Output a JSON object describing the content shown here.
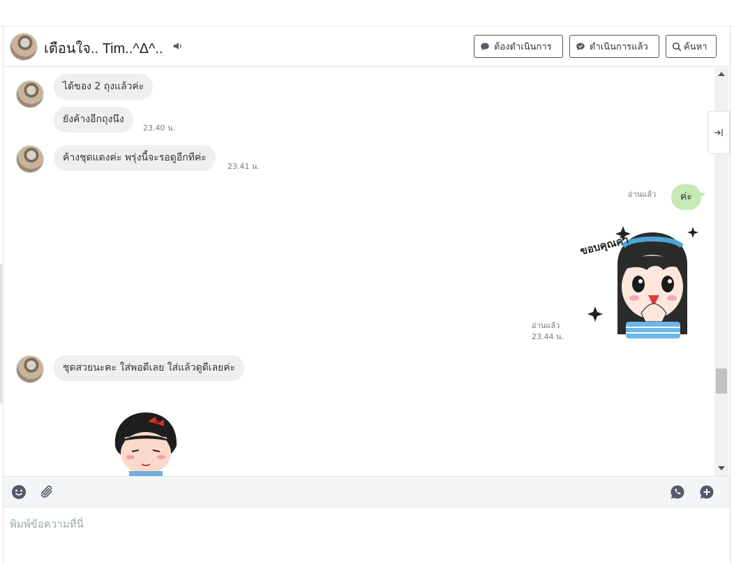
{
  "header": {
    "contact_name": "เตือนใจ.. Tim..^Δ^..",
    "btn_todo": "ต้องดำเนินการ",
    "btn_done": "ดำเนินการแล้ว",
    "btn_search": "ค้นหา"
  },
  "messages": [
    {
      "text": "ได้ของ 2 ถุงแล้วค่ะ"
    },
    {
      "text": "ยังค้างอีกถุงนึง",
      "time": "23.40 น."
    },
    {
      "text": "ค้างชุดแดงค่ะ พรุ่งนี้จะรอดูอีกทีค่ะ",
      "time": "23.41 น."
    },
    {
      "text": "ค่ะ",
      "read": "อ่านแล้ว"
    },
    {
      "sticker_text": "ขอบคุณค่า",
      "read": "อ่านแล้ว",
      "time": "23.44 น."
    },
    {
      "text": "ชุดสวยนะคะ  ใส่พอดีเลย  ใส่แล้วดูดีเลยค่ะ"
    }
  ],
  "compose": {
    "placeholder": "พิมพ์ข้อความที่นี่"
  },
  "colors": {
    "my_bubble": "#c6e9b5",
    "their_bubble": "#efefef",
    "icon_gray": "#555b66"
  },
  "icons": {
    "toggle": "arrow-right-to-line-icon",
    "speaker": "speaker-icon",
    "emoji": "emoji-icon",
    "attach": "paperclip-icon",
    "call": "phone-icon",
    "add_chat": "chat-plus-icon"
  }
}
